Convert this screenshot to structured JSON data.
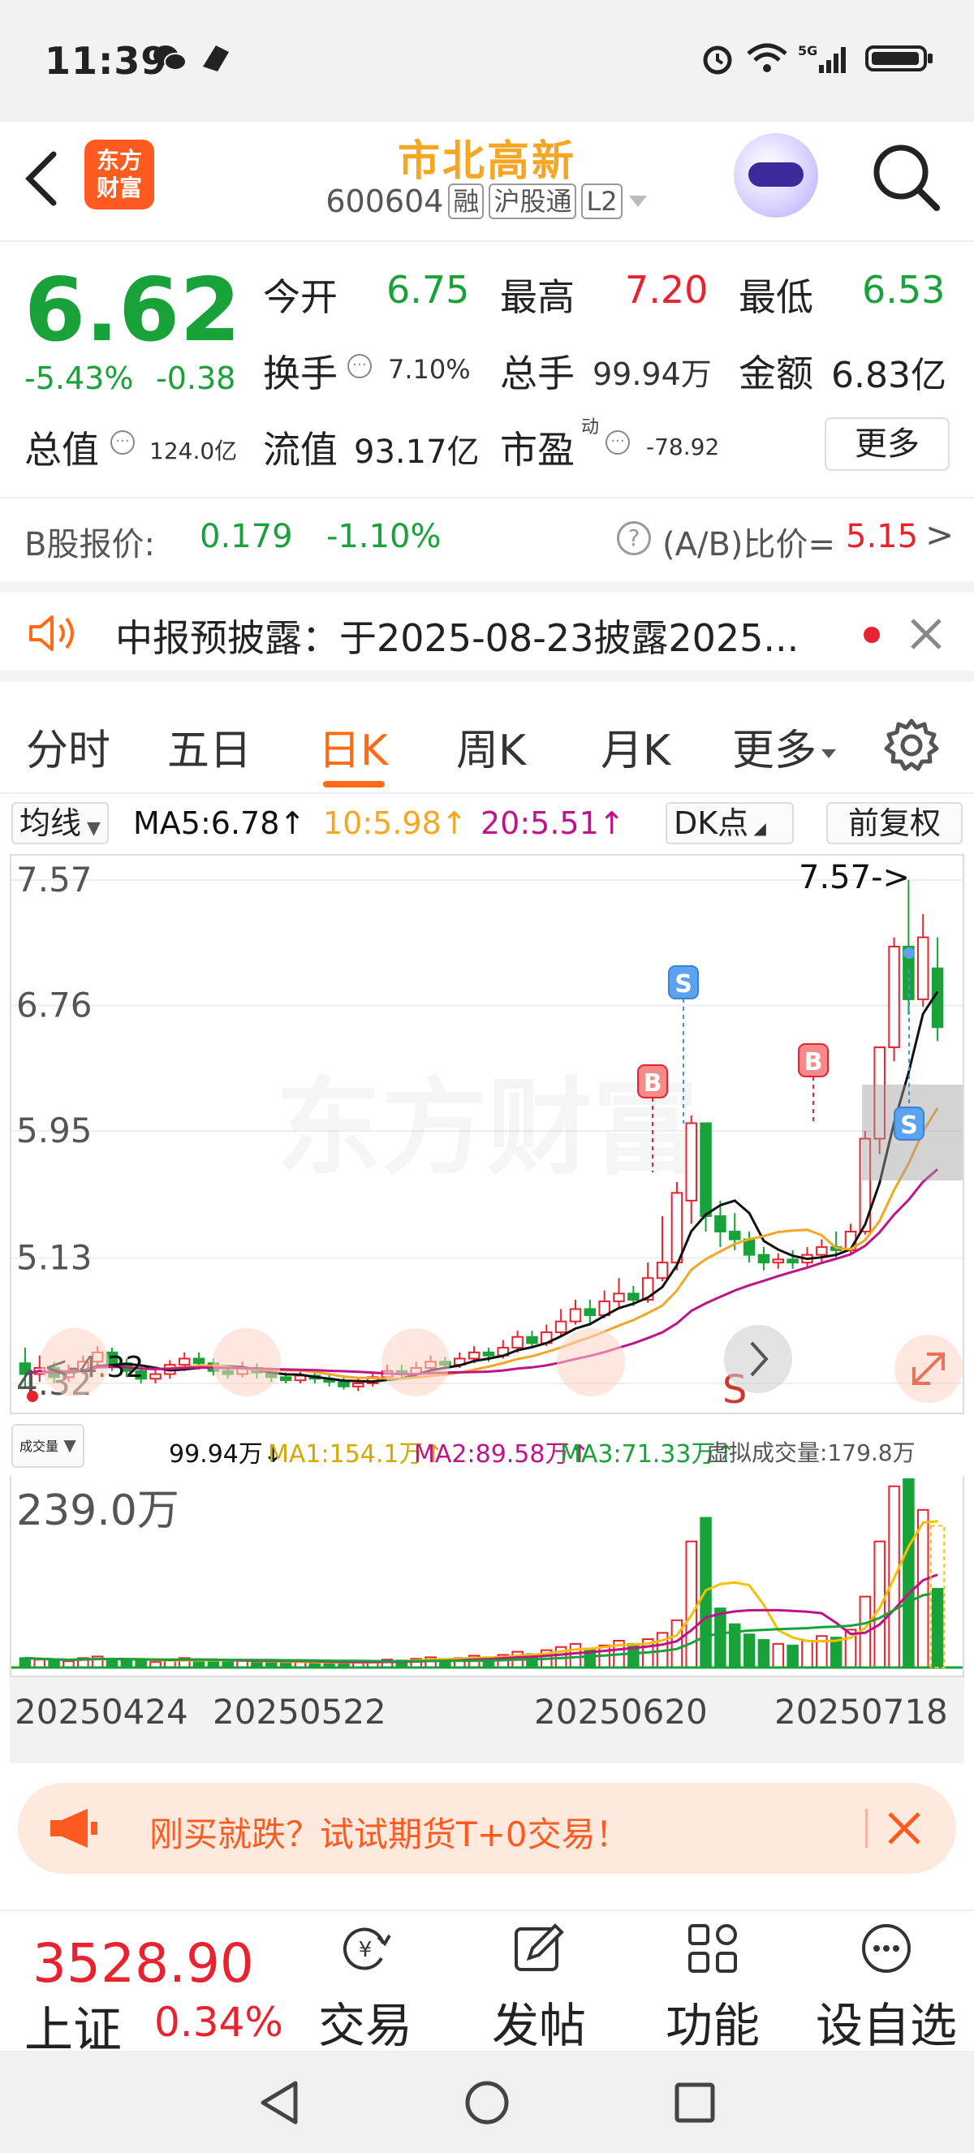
{
  "status_bar": {
    "time": "11:39"
  },
  "header": {
    "stock_name": "市北高新",
    "stock_code": "600604",
    "tags": [
      "融",
      "沪股通",
      "L2"
    ],
    "logo_text_1": "东方",
    "logo_text_2": "财富"
  },
  "quote": {
    "price": "6.62",
    "change_pct": "-5.43%",
    "change": "-0.38",
    "open_label": "今开",
    "open": "6.75",
    "high_label": "最高",
    "high": "7.20",
    "low_label": "最低",
    "low": "6.53",
    "turnover_label": "换手",
    "turnover": "7.10%",
    "volume_label": "总手",
    "volume": "99.94万",
    "amount_label": "金额",
    "amount": "6.83亿",
    "mcap_label": "总值",
    "mcap": "124.0亿",
    "float_label": "流值",
    "float": "93.17亿",
    "pe_label": "市盈",
    "pe_sup": "动",
    "pe": "-78.92",
    "more": "更多"
  },
  "b_share": {
    "label": "B股报价:",
    "price": "0.179",
    "change": "-1.10%",
    "ratio_label": "(A/B)比价=",
    "ratio": "5.15",
    "arrow": ">"
  },
  "announcement": {
    "text": "中报预披露：于2025-08-23披露2025..."
  },
  "tabs": [
    "分时",
    "五日",
    "日K",
    "周K",
    "月K",
    "更多"
  ],
  "ma_row": {
    "select": "均线",
    "ma5": "MA5:6.78↑",
    "ma10": "10:5.98↑",
    "ma20": "20:5.51↑",
    "dk": "DK点",
    "adjust": "前复权"
  },
  "kchart": {
    "price_labels": [
      "7.57",
      "6.76",
      "5.95",
      "5.13",
      "4.32"
    ],
    "max_annotation": "7.57->",
    "min_annotation": "<-4.32",
    "watermark": "东方财富",
    "marker_s": "S",
    "marker_b": "B",
    "mark_s_letter": "S"
  },
  "volume": {
    "select": "成交量",
    "value": "99.94万↓",
    "ma1": "MA1:154.1万↑",
    "ma2": "MA2:89.58万↑",
    "ma3": "MA3:71.33万↑",
    "virtual": "虚拟成交量:179.8万",
    "max_label": "239.0万"
  },
  "dates": [
    "20250424",
    "20250522",
    "20250620",
    "20250718"
  ],
  "promo": {
    "text": "刚买就跌？试试期货T+0交易！"
  },
  "bottom_bar": {
    "index_value": "3528.90",
    "index_name": "上证",
    "index_change": "0.34%",
    "items": [
      "交易",
      "发帖",
      "功能",
      "设自选"
    ]
  },
  "colors": {
    "up": "#e8232f",
    "down": "#19a23a",
    "accent": "#ff6a13",
    "ma5": "#111111",
    "ma10": "#f5a623",
    "ma20": "#c0138a"
  },
  "chart_data": {
    "type": "candlestick",
    "title": "",
    "xlabel": "",
    "ylabel": "",
    "ylim": [
      4.32,
      7.57
    ],
    "x_ticks": [
      "20250424",
      "20250522",
      "20250620",
      "20250718"
    ],
    "candles": [
      [
        4.45,
        4.38,
        4.55,
        4.3
      ],
      [
        4.38,
        4.42,
        4.5,
        4.33
      ],
      [
        4.42,
        4.36,
        4.46,
        4.32
      ],
      [
        4.36,
        4.4,
        4.44,
        4.33
      ],
      [
        4.4,
        4.46,
        4.5,
        4.38
      ],
      [
        4.46,
        4.52,
        4.56,
        4.42
      ],
      [
        4.52,
        4.45,
        4.55,
        4.4
      ],
      [
        4.45,
        4.4,
        4.48,
        4.36
      ],
      [
        4.4,
        4.35,
        4.44,
        4.32
      ],
      [
        4.35,
        4.38,
        4.42,
        4.32
      ],
      [
        4.38,
        4.44,
        4.47,
        4.35
      ],
      [
        4.44,
        4.48,
        4.52,
        4.4
      ],
      [
        4.48,
        4.45,
        4.52,
        4.41
      ],
      [
        4.45,
        4.4,
        4.48,
        4.37
      ],
      [
        4.4,
        4.38,
        4.43,
        4.35
      ],
      [
        4.38,
        4.42,
        4.46,
        4.36
      ],
      [
        4.42,
        4.39,
        4.45,
        4.35
      ],
      [
        4.39,
        4.36,
        4.42,
        4.33
      ],
      [
        4.36,
        4.34,
        4.39,
        4.32
      ],
      [
        4.34,
        4.37,
        4.4,
        4.32
      ],
      [
        4.37,
        4.35,
        4.4,
        4.32
      ],
      [
        4.35,
        4.33,
        4.38,
        4.3
      ],
      [
        4.33,
        4.3,
        4.36,
        4.28
      ],
      [
        4.3,
        4.32,
        4.35,
        4.27
      ],
      [
        4.32,
        4.36,
        4.39,
        4.3
      ],
      [
        4.36,
        4.4,
        4.44,
        4.34
      ],
      [
        4.4,
        4.38,
        4.44,
        4.35
      ],
      [
        4.38,
        4.42,
        4.46,
        4.36
      ],
      [
        4.42,
        4.46,
        4.5,
        4.4
      ],
      [
        4.46,
        4.44,
        4.49,
        4.41
      ],
      [
        4.44,
        4.48,
        4.52,
        4.42
      ],
      [
        4.48,
        4.52,
        4.56,
        4.45
      ],
      [
        4.52,
        4.5,
        4.55,
        4.46
      ],
      [
        4.5,
        4.55,
        4.6,
        4.48
      ],
      [
        4.55,
        4.62,
        4.66,
        4.52
      ],
      [
        4.62,
        4.58,
        4.66,
        4.55
      ],
      [
        4.58,
        4.65,
        4.7,
        4.56
      ],
      [
        4.65,
        4.72,
        4.8,
        4.62
      ],
      [
        4.72,
        4.8,
        4.86,
        4.7
      ],
      [
        4.8,
        4.76,
        4.86,
        4.7
      ],
      [
        4.76,
        4.85,
        4.92,
        4.74
      ],
      [
        4.85,
        4.9,
        5.0,
        4.8
      ],
      [
        4.9,
        4.86,
        4.95,
        4.82
      ],
      [
        4.86,
        5.0,
        5.1,
        4.84
      ],
      [
        5.0,
        5.1,
        5.4,
        4.98
      ],
      [
        5.1,
        5.55,
        5.62,
        5.05
      ],
      [
        5.5,
        6.0,
        6.05,
        5.35
      ],
      [
        6.0,
        5.4,
        6.0,
        5.3
      ],
      [
        5.4,
        5.3,
        5.5,
        5.2
      ],
      [
        5.3,
        5.25,
        5.42,
        5.18
      ],
      [
        5.25,
        5.15,
        5.3,
        5.1
      ],
      [
        5.15,
        5.1,
        5.2,
        5.05
      ],
      [
        5.1,
        5.12,
        5.16,
        5.06
      ],
      [
        5.12,
        5.1,
        5.18,
        5.06
      ],
      [
        5.1,
        5.15,
        5.2,
        5.06
      ],
      [
        5.15,
        5.2,
        5.25,
        5.1
      ],
      [
        5.2,
        5.18,
        5.3,
        5.12
      ],
      [
        5.18,
        5.3,
        5.35,
        5.15
      ],
      [
        5.3,
        5.9,
        5.95,
        5.28
      ],
      [
        5.9,
        6.49,
        6.49,
        5.8
      ],
      [
        6.49,
        7.14,
        7.2,
        6.4
      ],
      [
        7.14,
        6.8,
        7.57,
        6.7
      ],
      [
        6.8,
        7.2,
        7.35,
        6.75
      ],
      [
        7.0,
        6.62,
        7.2,
        6.53
      ]
    ],
    "volume_ylim": [
      0,
      239.0
    ],
    "volumes": [
      12,
      10,
      9,
      8,
      12,
      14,
      11,
      9,
      8,
      7,
      10,
      12,
      9,
      8,
      7,
      9,
      8,
      7,
      6,
      7,
      6,
      6,
      7,
      6,
      8,
      10,
      9,
      11,
      13,
      10,
      12,
      15,
      13,
      16,
      20,
      17,
      22,
      26,
      30,
      24,
      28,
      34,
      30,
      36,
      44,
      60,
      160,
      190,
      75,
      55,
      42,
      35,
      30,
      28,
      34,
      40,
      38,
      48,
      90,
      160,
      230,
      239,
      200,
      99.94
    ]
  }
}
